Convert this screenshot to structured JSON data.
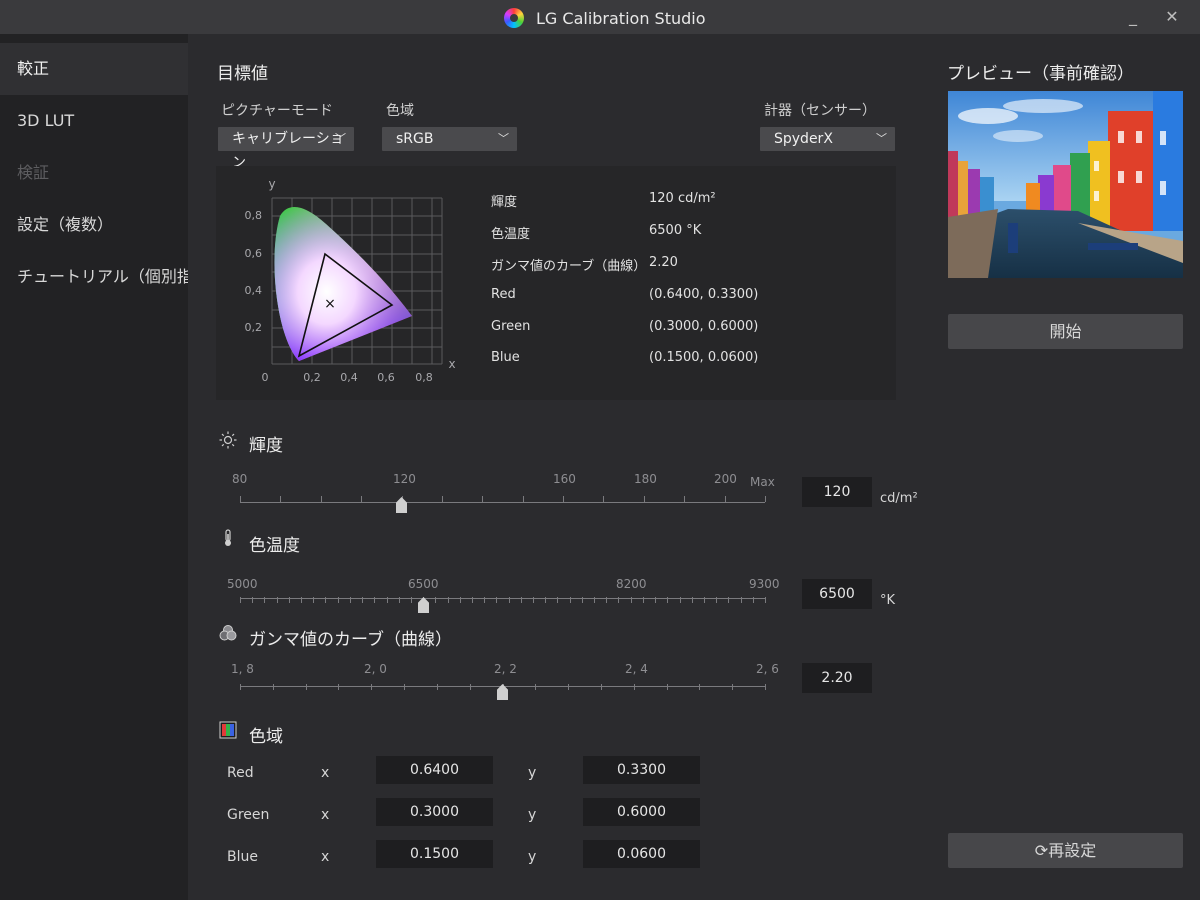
{
  "window": {
    "title": "LG Calibration Studio",
    "minimize_label": "_",
    "close_label": "✕"
  },
  "sidebar": {
    "items": [
      {
        "label": "較正",
        "state": "active"
      },
      {
        "label": "3D LUT",
        "state": "normal"
      },
      {
        "label": "検証",
        "state": "disabled"
      },
      {
        "label": "設定（複数）",
        "state": "normal"
      },
      {
        "label": "チュートリアル（個別指導）",
        "state": "normal"
      }
    ]
  },
  "target": {
    "title": "目標値",
    "picture_mode": {
      "label": "ピクチャーモード",
      "value": "キャリブレーション"
    },
    "gamut": {
      "label": "色域",
      "value": "sRGB"
    },
    "sensor": {
      "label": "計器（センサー）",
      "value": "SpyderX"
    },
    "chart": {
      "y_axis_letter": "y",
      "x_axis_letter": "x",
      "y_ticks": [
        "0,8",
        "0,6",
        "0,4",
        "0,2"
      ],
      "x_ticks": [
        "0",
        "0,2",
        "0,4",
        "0,6",
        "0,8"
      ],
      "white_point_marker": "×"
    },
    "info": [
      {
        "label": "輝度",
        "value": "120 cd/m²"
      },
      {
        "label": "色温度",
        "value": "6500 °K"
      },
      {
        "label": "ガンマ値のカーブ（曲線）",
        "value": "2.20"
      },
      {
        "label": "Red",
        "value": "(0.6400, 0.3300)"
      },
      {
        "label": "Green",
        "value": "(0.3000, 0.6000)"
      },
      {
        "label": "Blue",
        "value": "(0.1500, 0.0600)"
      }
    ]
  },
  "brightness": {
    "title": "輝度",
    "icon": "sun-icon",
    "ticks": [
      "80",
      "120",
      "160",
      "180",
      "200",
      "Max"
    ],
    "value": "120",
    "unit": "cd/m²"
  },
  "color_temperature": {
    "title": "色温度",
    "icon": "thermometer-icon",
    "ticks": [
      "5000",
      "6500",
      "8200",
      "9300"
    ],
    "value": "6500",
    "unit": "°K"
  },
  "gamma": {
    "title": "ガンマ値のカーブ（曲線）",
    "icon": "rgb-circles-icon",
    "ticks": [
      "1, 8",
      "2, 0",
      "2, 2",
      "2, 4",
      "2, 6"
    ],
    "value": "2.20"
  },
  "gamut_section": {
    "title": "色域",
    "icon": "gamut-icon",
    "x_letter": "x",
    "y_letter": "y",
    "rows": [
      {
        "name": "Red",
        "x": "0.6400",
        "y": "0.3300"
      },
      {
        "name": "Green",
        "x": "0.3000",
        "y": "0.6000"
      },
      {
        "name": "Blue",
        "x": "0.1500",
        "y": "0.0600"
      }
    ]
  },
  "preview": {
    "title": "プレビュー（事前確認）",
    "start_button": "開始",
    "reset_button": "再設定"
  }
}
